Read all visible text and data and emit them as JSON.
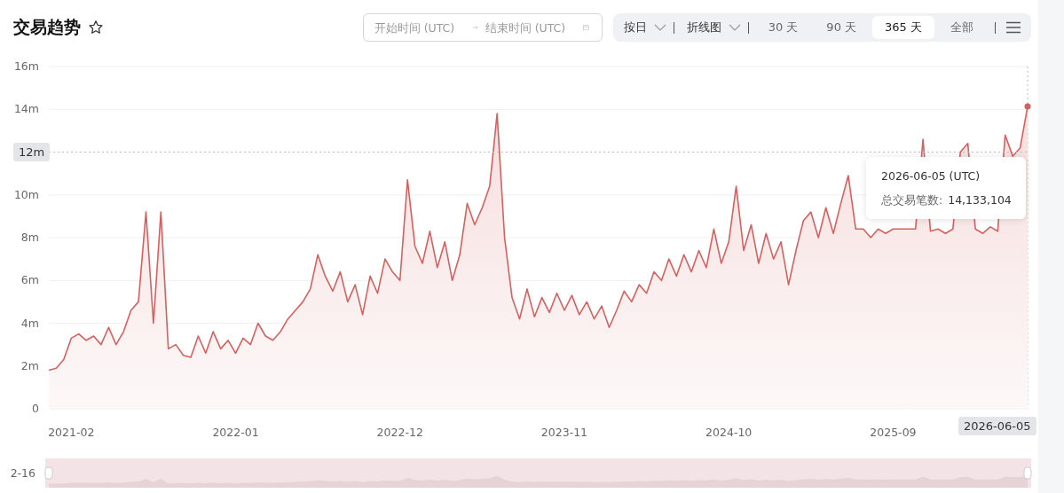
{
  "title": "交易趋势",
  "date_range": {
    "start_placeholder": "开始时间 (UTC)",
    "end_placeholder": "结束时间 (UTC)"
  },
  "toolbar": {
    "dropdowns": [
      {
        "label": "按日"
      },
      {
        "label": "折线图"
      }
    ],
    "ranges": [
      {
        "label": "30 天",
        "selected": false
      },
      {
        "label": "90 天",
        "selected": false
      },
      {
        "label": "365 天",
        "selected": true
      },
      {
        "label": "全部",
        "selected": false
      }
    ]
  },
  "chart_data": {
    "type": "area",
    "grid": true,
    "categories": [
      null,
      null,
      null,
      "2021-02",
      null,
      null,
      null,
      null,
      null,
      null,
      null,
      null,
      null,
      null,
      null,
      null,
      null,
      null,
      null,
      null,
      null,
      null,
      null,
      null,
      null,
      "2022-01",
      null,
      null,
      null,
      null,
      null,
      null,
      null,
      null,
      null,
      null,
      null,
      null,
      null,
      null,
      null,
      null,
      null,
      null,
      null,
      null,
      null,
      "2022-12",
      null,
      null,
      null,
      null,
      null,
      null,
      null,
      null,
      null,
      null,
      null,
      null,
      null,
      null,
      null,
      null,
      null,
      null,
      null,
      null,
      null,
      "2023-11",
      null,
      null,
      null,
      null,
      null,
      null,
      null,
      null,
      null,
      null,
      null,
      null,
      null,
      null,
      null,
      null,
      null,
      null,
      null,
      null,
      null,
      "2024-10",
      null,
      null,
      null,
      null,
      null,
      null,
      null,
      null,
      null,
      null,
      null,
      null,
      null,
      null,
      null,
      null,
      null,
      null,
      null,
      null,
      null,
      "2025-09",
      null,
      null,
      null,
      null,
      null,
      null,
      null,
      null,
      null,
      null,
      null,
      null,
      null,
      null,
      null,
      null,
      null,
      null
    ],
    "ylim": [
      0,
      16
    ],
    "yticks": [
      {
        "value": 0,
        "label": "0"
      },
      {
        "value": 2,
        "label": "2m"
      },
      {
        "value": 4,
        "label": "4m"
      },
      {
        "value": 6,
        "label": "6m"
      },
      {
        "value": 8,
        "label": "8m"
      },
      {
        "value": 10,
        "label": "10m"
      },
      {
        "value": 14,
        "label": "14m"
      },
      {
        "value": 16,
        "label": "16m"
      }
    ],
    "values": [
      1.8,
      1.9,
      2.3,
      3.3,
      3.5,
      3.2,
      3.4,
      3.0,
      3.8,
      3.0,
      3.6,
      4.6,
      5.0,
      9.2,
      4.0,
      9.2,
      2.8,
      3.0,
      2.5,
      2.4,
      3.4,
      2.6,
      3.6,
      2.8,
      3.2,
      2.6,
      3.3,
      3.0,
      4.0,
      3.4,
      3.2,
      3.6,
      4.2,
      4.6,
      5.0,
      5.6,
      7.2,
      6.2,
      5.5,
      6.4,
      5.0,
      5.8,
      4.4,
      6.2,
      5.4,
      7.0,
      6.4,
      6.0,
      10.7,
      7.6,
      6.8,
      8.3,
      6.6,
      7.8,
      6.0,
      7.2,
      9.6,
      8.6,
      9.4,
      10.4,
      13.8,
      8.0,
      5.2,
      4.2,
      5.6,
      4.3,
      5.2,
      4.5,
      5.4,
      4.6,
      5.3,
      4.4,
      5.0,
      4.2,
      4.8,
      3.8,
      4.6,
      5.5,
      5.0,
      5.8,
      5.4,
      6.4,
      6.0,
      7.0,
      6.2,
      7.2,
      6.4,
      7.4,
      6.6,
      8.4,
      6.8,
      7.8,
      10.4,
      7.4,
      8.6,
      6.8,
      8.2,
      7.0,
      7.8,
      5.8,
      7.4,
      8.8,
      9.2,
      8.0,
      9.4,
      8.2,
      9.6,
      10.9,
      8.4,
      8.4,
      8.0,
      8.4,
      8.2,
      8.4,
      8.4,
      8.4,
      8.4,
      12.6,
      8.3,
      8.4,
      8.2,
      8.4,
      12.0,
      12.4,
      8.4,
      8.2,
      8.5,
      8.3,
      12.8,
      11.8,
      12.2,
      14.13
    ],
    "ref_lines": [
      {
        "axis": "y",
        "value": 12,
        "label": "12m"
      }
    ]
  },
  "axis_pointer": {
    "x_label": "2026-06-05"
  },
  "tooltip": {
    "title": "2026-06-05 (UTC)",
    "label": "总交易笔数:",
    "value": "14,133,104"
  },
  "data_zoom": {
    "start_label": "2-16"
  }
}
